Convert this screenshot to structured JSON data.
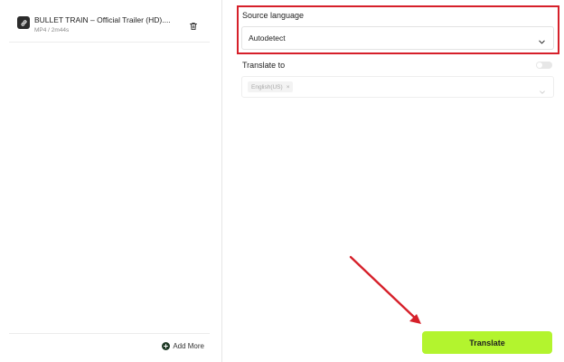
{
  "files": [
    {
      "title": "BULLET TRAIN – Official Trailer (HD)....",
      "meta": "MP4 / 2m44s"
    }
  ],
  "left_footer": {
    "add_more_label": "Add More"
  },
  "source_language": {
    "label": "Source language",
    "value": "Autodetect"
  },
  "translate_to": {
    "label": "Translate to",
    "toggle_on": false,
    "selected_tag": "English(US)"
  },
  "actions": {
    "translate_label": "Translate"
  },
  "colors": {
    "accent_green": "#b3f42e",
    "highlight_red": "#d6202a",
    "icon_dark": "#2b2b2b",
    "add_icon_dark_green": "#1f3a26"
  },
  "icons": {
    "file": "link-icon",
    "delete": "trash-icon",
    "add": "plus-circle-icon",
    "dropdown": "chevron-down-icon",
    "tag_remove": "close-icon"
  }
}
